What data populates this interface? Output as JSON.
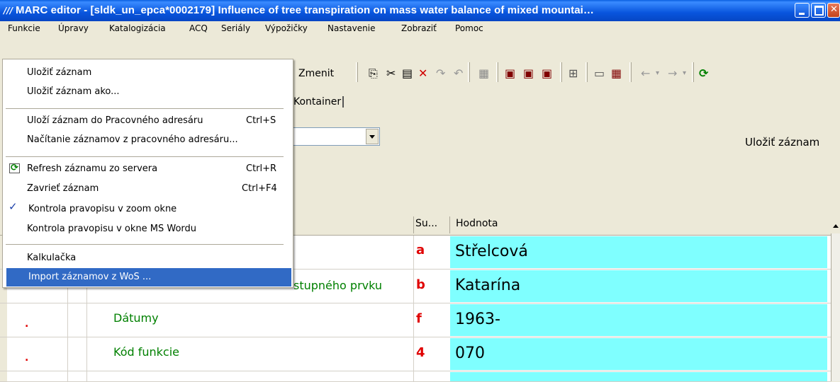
{
  "window": {
    "title": "MARC editor - [sldk_un_epca*0002179] Influence of tree transpiration on mass water balance of mixed mountai…",
    "app_icon": "///"
  },
  "menubar": [
    "Funkcie",
    "Úpravy",
    "Katalogizácia",
    "ACQ",
    "Seriály",
    "Výpožičky",
    "Nastavenie",
    "Zobraziť",
    "Pomoc"
  ],
  "toolbar": {
    "zmenit_label": "Zmenit"
  },
  "tabs": {
    "kontainer": "Kontainer"
  },
  "save_label": "Uložiť záznam",
  "grid": {
    "headers": {
      "subfield": "Su...",
      "value": "Hodnota"
    },
    "rows": [
      {
        "name": "",
        "subfield": "a",
        "value": "Střelcová",
        "dot": ""
      },
      {
        "name": "stupného prvku",
        "subfield": "b",
        "value": "Katarína",
        "dot": ""
      },
      {
        "name": "Dátumy",
        "subfield": "f",
        "value": "1963-",
        "dot": "."
      },
      {
        "name": "Kód funkcie",
        "subfield": "4",
        "value": "070",
        "dot": "."
      }
    ]
  },
  "dropdown": {
    "items": [
      {
        "label": "Uložiť záznam",
        "shortcut": ""
      },
      {
        "label": "Uložiť záznam ako...",
        "shortcut": ""
      },
      {
        "label": "Uloží záznam do Pracovného adresáru",
        "shortcut": "Ctrl+S"
      },
      {
        "label": "Načítanie záznamov z pracovného adresáru...",
        "shortcut": ""
      },
      {
        "label": "Refresh záznamu zo servera",
        "shortcut": "Ctrl+R",
        "icon": "refresh-icon"
      },
      {
        "label": "Zavrieť záznam",
        "shortcut": "Ctrl+F4"
      },
      {
        "label": "Kontrola pravopisu v zoom okne",
        "shortcut": "",
        "icon": "spellcheck-icon"
      },
      {
        "label": "Kontrola pravopisu v okne MS Wordu",
        "shortcut": ""
      },
      {
        "label": "Kalkulačka",
        "shortcut": ""
      },
      {
        "label": "Import záznamov z WoS ...",
        "shortcut": "",
        "highlighted": true
      }
    ]
  },
  "colors": {
    "highlight": "#316ac5",
    "value_cell": "#7fffff",
    "field_name": "#008000",
    "subfield": "#e00000"
  }
}
